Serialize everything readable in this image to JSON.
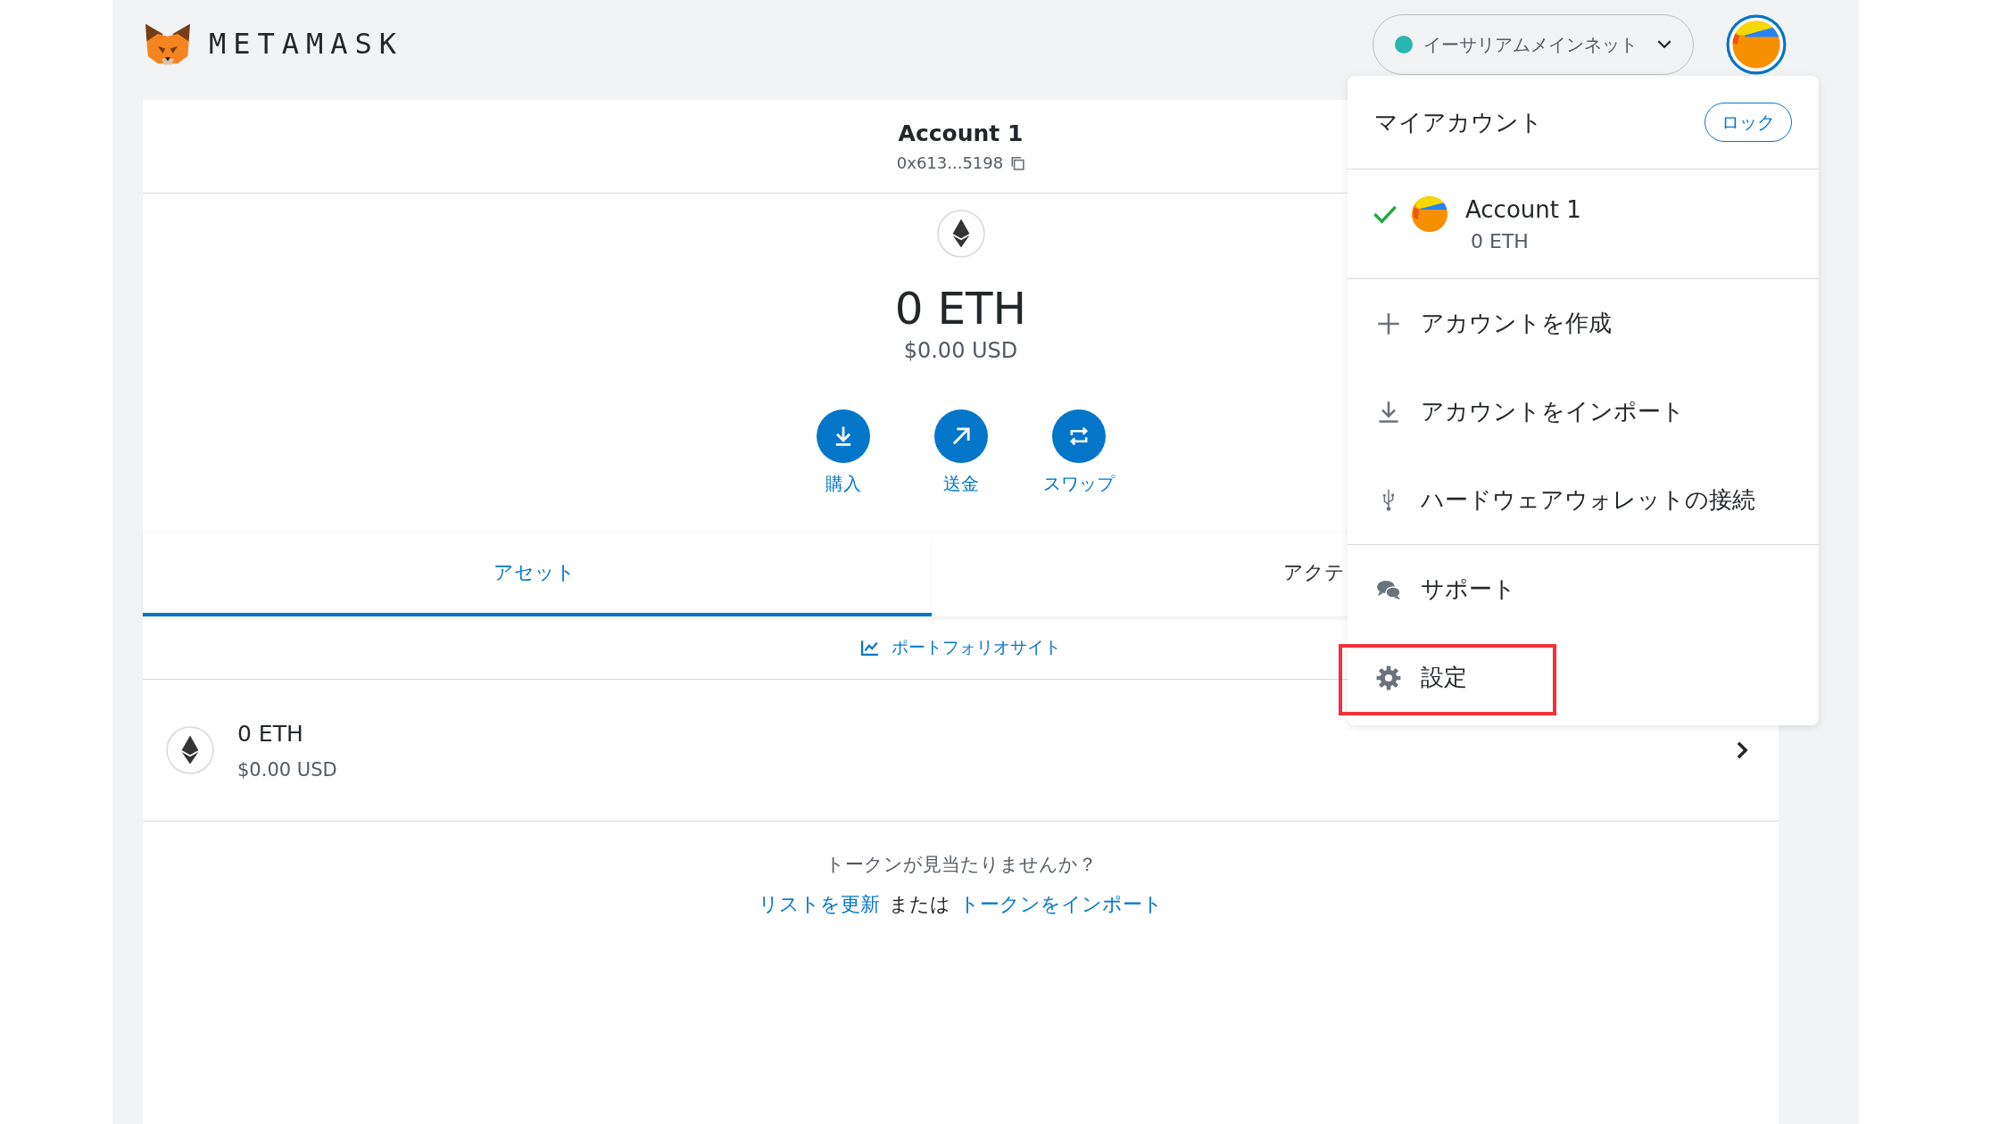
{
  "header": {
    "logo_text": "METAMASK",
    "network": {
      "label": "イーサリアムメインネット",
      "color": "#29b6af"
    }
  },
  "account": {
    "name": "Account 1",
    "address": "0x613...5198"
  },
  "balance": {
    "amount": "0 ETH",
    "fiat": "$0.00 USD"
  },
  "actions": [
    {
      "kind": "buy",
      "label": "購入"
    },
    {
      "kind": "send",
      "label": "送金"
    },
    {
      "kind": "swap",
      "label": "スワップ"
    }
  ],
  "tabs": [
    {
      "label": "アセット",
      "selected": true
    },
    {
      "label": "アクテ",
      "selected": false
    }
  ],
  "portfolio_link": "ポートフォリオサイト",
  "assets": [
    {
      "amount": "0 ETH",
      "fiat": "$0.00 USD"
    }
  ],
  "token_help": {
    "question": "トークンが見当たりませんか？",
    "refresh_link": "リストを更新",
    "or": "または",
    "import_link": "トークンをインポート"
  },
  "account_menu": {
    "title": "マイアカウント",
    "lock_button": "ロック",
    "accounts": [
      {
        "name": "Account 1",
        "balance": "0 ETH",
        "selected": true
      }
    ],
    "item_groups": [
      [
        {
          "kind": "create",
          "label": "アカウントを作成",
          "highlighted": false
        },
        {
          "kind": "import",
          "label": "アカウントをインポート",
          "highlighted": false
        },
        {
          "kind": "hardware",
          "label": "ハードウェアウォレットの接続",
          "highlighted": false
        }
      ],
      [
        {
          "kind": "support",
          "label": "サポート",
          "highlighted": false
        },
        {
          "kind": "settings",
          "label": "設定",
          "highlighted": true
        }
      ]
    ]
  }
}
